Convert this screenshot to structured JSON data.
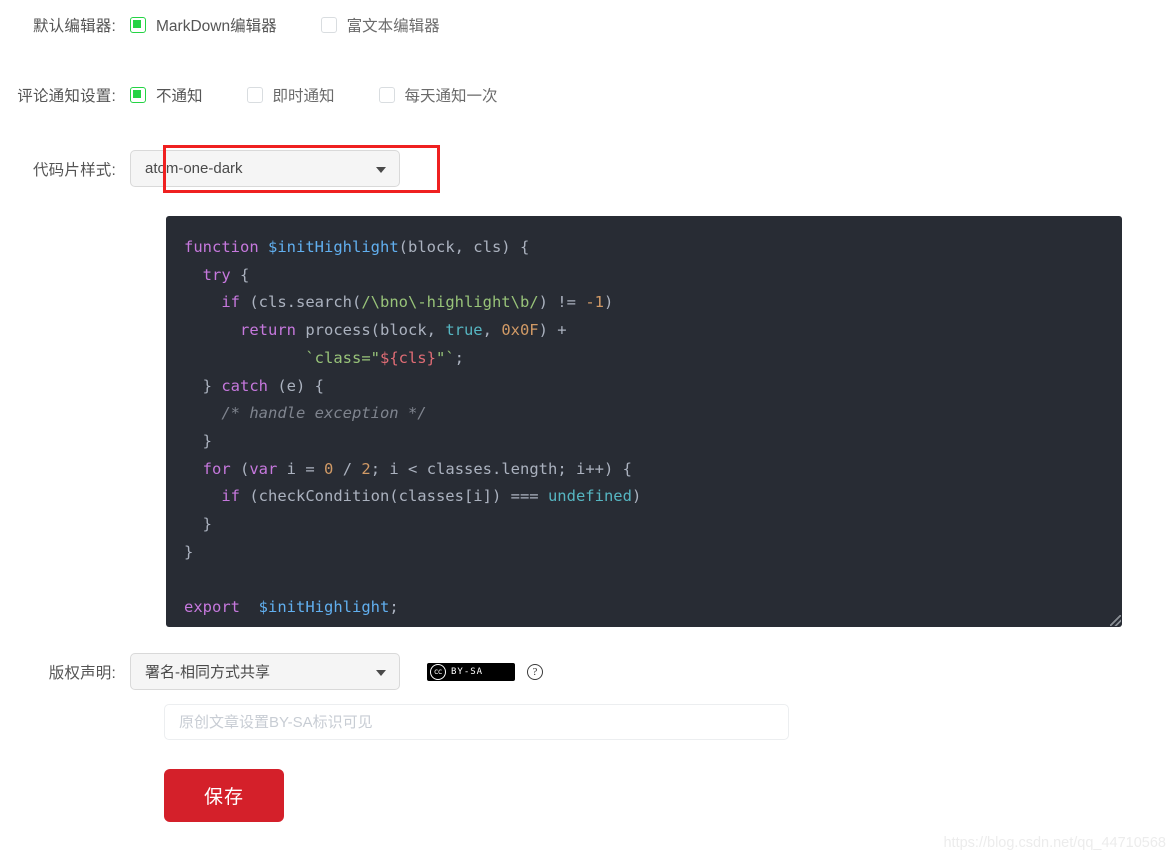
{
  "rows": {
    "editor": {
      "label": "默认编辑器:",
      "options": [
        {
          "label": "MarkDown编辑器",
          "checked": true
        },
        {
          "label": "富文本编辑器",
          "checked": false
        }
      ]
    },
    "comment_notify": {
      "label": "评论通知设置:",
      "options": [
        {
          "label": "不通知",
          "checked": true
        },
        {
          "label": "即时通知",
          "checked": false
        },
        {
          "label": "每天通知一次",
          "checked": false
        }
      ]
    },
    "code_style": {
      "label": "代码片样式:",
      "value": "atom-one-dark",
      "caret": "chevron-down-icon"
    },
    "copyright": {
      "label": "版权声明:",
      "value": "署名-相同方式共享",
      "caret": "chevron-down-icon",
      "badge_mark": "cc",
      "badge_text": "BY-SA",
      "help": "?"
    }
  },
  "declaration_input": {
    "value": "",
    "placeholder": "原创文章设置BY-SA标识可见"
  },
  "save_button": {
    "label": "保存"
  },
  "watermark": {
    "text": "https://blog.csdn.net/qq_44710568"
  },
  "code_preview": {
    "theme": "atom-one-dark",
    "background": "#282c34",
    "lines": [
      "function $initHighlight(block, cls) {",
      "  try {",
      "    if (cls.search(/\\bno\\-highlight\\b/) != -1)",
      "      return process(block, true, 0x0F) +",
      "             `class=\"${cls}\"`;",
      "  } catch (e) {",
      "    /* handle exception */",
      "  }",
      "  for (var i = 0 / 2; i < classes.length; i++) {",
      "    if (checkCondition(classes[i]) === undefined)",
      "  }",
      "}",
      "",
      "export  $initHighlight;"
    ],
    "token_colors": {
      "keyword": "#c678dd",
      "function": "#61afef",
      "string": "#98c379",
      "number": "#d19a66",
      "literal": "#56b6c2",
      "variable": "#e06c75",
      "comment": "#7f848e",
      "default": "#abb2bf"
    }
  },
  "annotation": {
    "highlight_color": "#ef2020",
    "target": "code_style_select"
  }
}
